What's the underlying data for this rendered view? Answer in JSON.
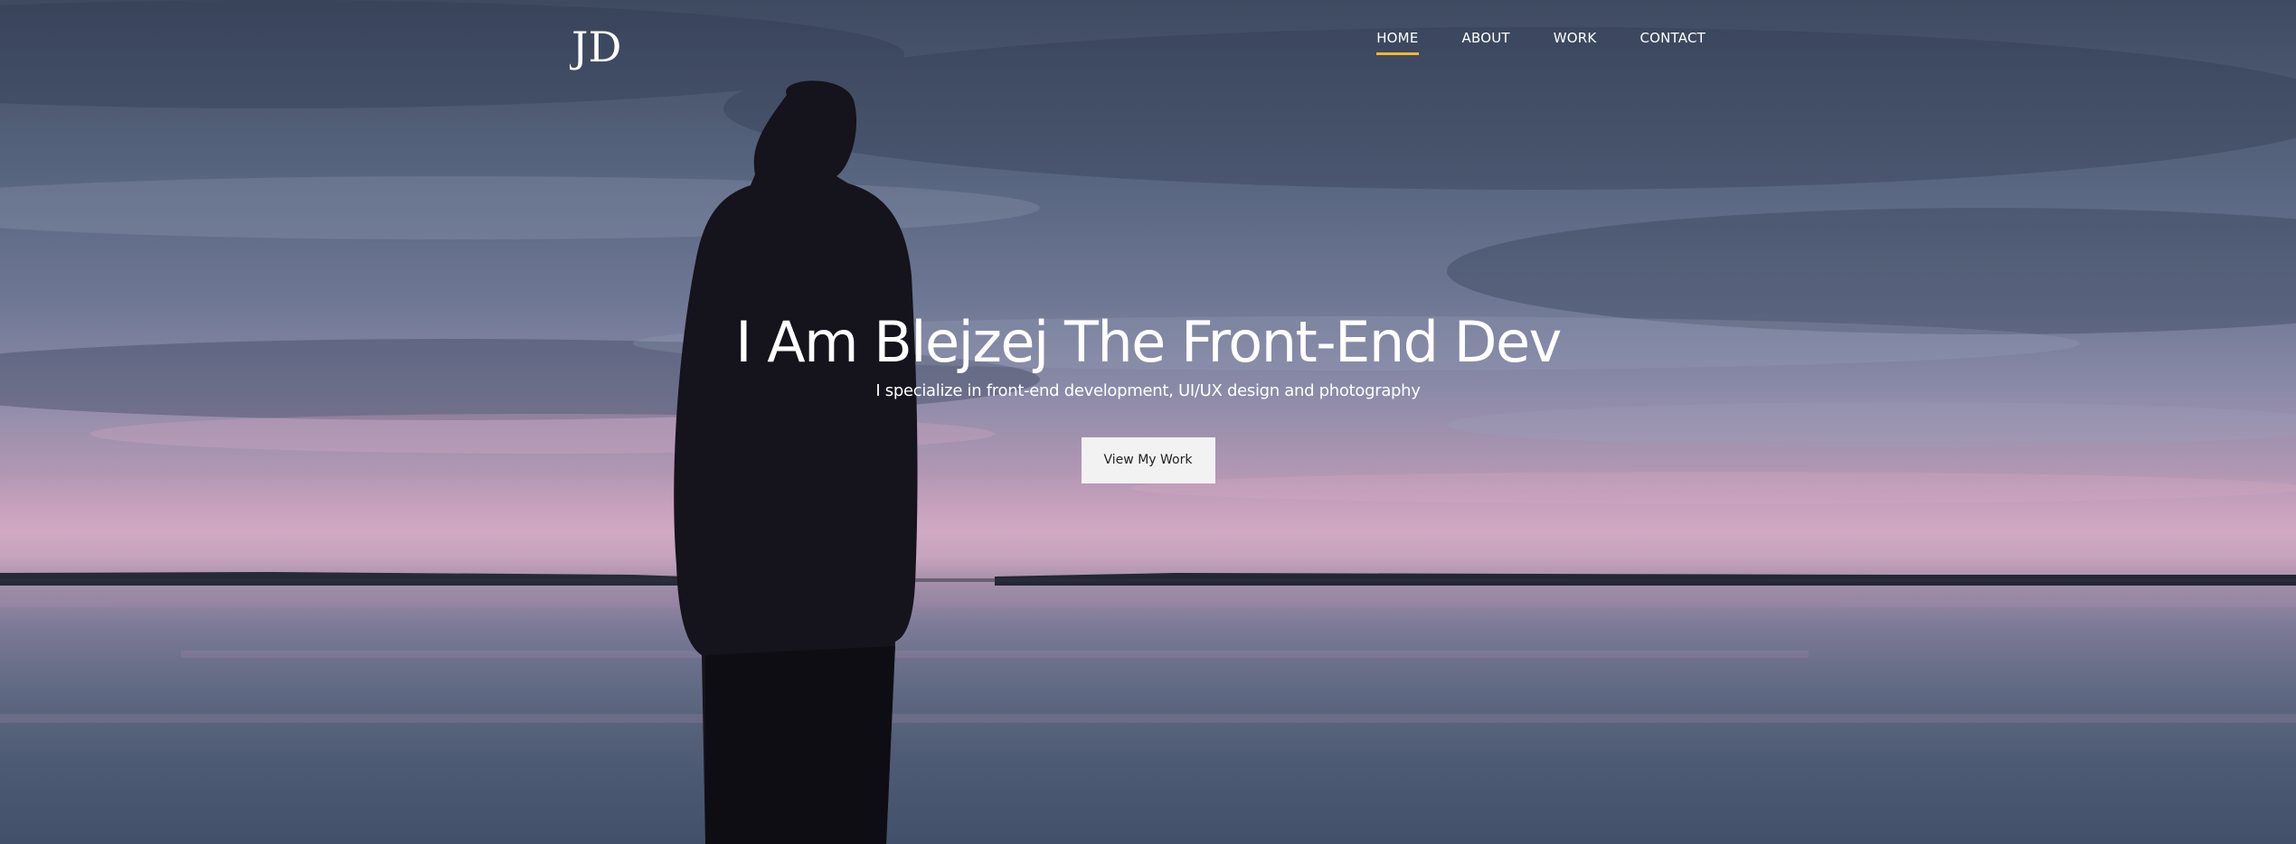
{
  "header": {
    "logo_text": "JD",
    "nav": [
      {
        "label": "HOME",
        "active": true
      },
      {
        "label": "ABOUT",
        "active": false
      },
      {
        "label": "WORK",
        "active": false
      },
      {
        "label": "CONTACT",
        "active": false
      }
    ]
  },
  "hero": {
    "title": "I Am Blejzej The Front-End Dev",
    "subtitle": "I specialize in front-end development, UI/UX design and photography",
    "cta_label": "View My Work"
  },
  "colors": {
    "accent": "#f1b82d",
    "button_bg": "#f2f2f2",
    "button_text": "#222222",
    "text": "#ffffff"
  }
}
